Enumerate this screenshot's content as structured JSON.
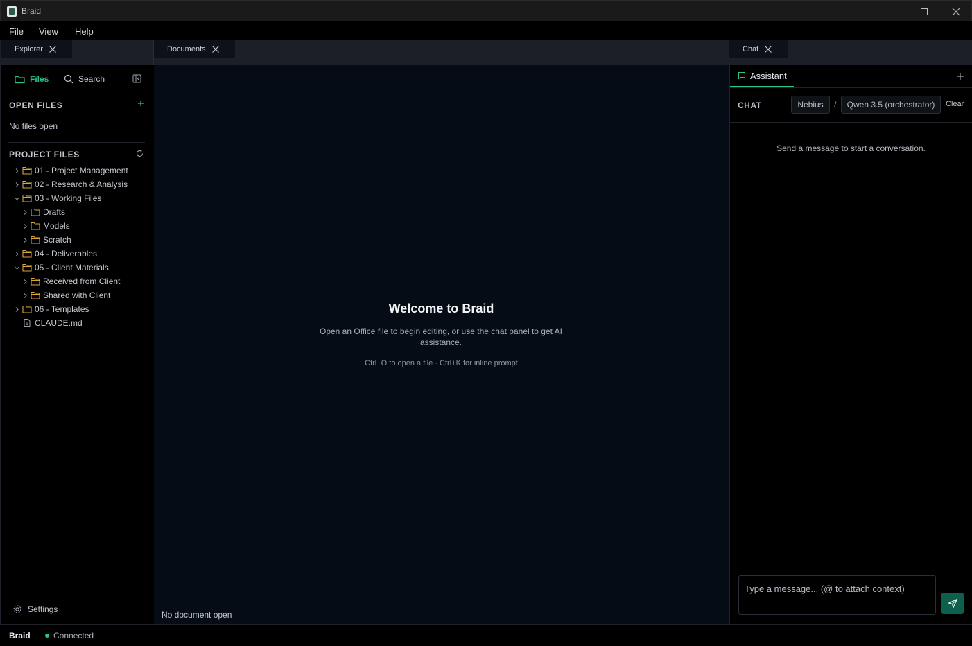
{
  "window": {
    "title": "Braid"
  },
  "menu": [
    "File",
    "View",
    "Help"
  ],
  "tabs": {
    "explorer": "Explorer",
    "documents": "Documents",
    "chat": "Chat"
  },
  "explorer": {
    "files_tab": "Files",
    "search_tab": "Search",
    "open_files_title": "OPEN FILES",
    "open_files_empty": "No files open",
    "project_files_title": "PROJECT FILES",
    "tree": [
      {
        "label": "01 - Project Management",
        "depth": 0,
        "type": "folder",
        "expanded": false
      },
      {
        "label": "02 - Research & Analysis",
        "depth": 0,
        "type": "folder",
        "expanded": false
      },
      {
        "label": "03 - Working Files",
        "depth": 0,
        "type": "folder",
        "expanded": true
      },
      {
        "label": "Drafts",
        "depth": 1,
        "type": "folder",
        "expanded": false
      },
      {
        "label": "Models",
        "depth": 1,
        "type": "folder",
        "expanded": false
      },
      {
        "label": "Scratch",
        "depth": 1,
        "type": "folder",
        "expanded": false
      },
      {
        "label": "04 - Deliverables",
        "depth": 0,
        "type": "folder",
        "expanded": false
      },
      {
        "label": "05 - Client Materials",
        "depth": 0,
        "type": "folder",
        "expanded": true
      },
      {
        "label": "Received from Client",
        "depth": 1,
        "type": "folder",
        "expanded": false
      },
      {
        "label": "Shared with Client",
        "depth": 1,
        "type": "folder",
        "expanded": false
      },
      {
        "label": "06 - Templates",
        "depth": 0,
        "type": "folder",
        "expanded": false
      },
      {
        "label": "CLAUDE.md",
        "depth": 0,
        "type": "file",
        "expanded": false
      }
    ],
    "settings_label": "Settings"
  },
  "documents": {
    "welcome_title": "Welcome to Braid",
    "welcome_text": "Open an Office file to begin editing, or use the chat panel to get AI assistance.",
    "shortcut_hint": "Ctrl+O to open a file · Ctrl+K for inline prompt",
    "status": "No document open"
  },
  "chat": {
    "assistant_tab": "Assistant",
    "header_label": "CHAT",
    "provider": "Nebius",
    "separator": "/",
    "model": "Qwen 3.5 (orchestrator)",
    "clear_label": "Clear",
    "empty_message": "Send a message to start a conversation.",
    "input_placeholder": "Type a message... (@ to attach context)"
  },
  "statusbar": {
    "app_name": "Braid",
    "connection": "Connected"
  },
  "colors": {
    "accent": "#2bbf8a",
    "folder": "#d9a53c",
    "send_button": "#0f5f4f"
  }
}
